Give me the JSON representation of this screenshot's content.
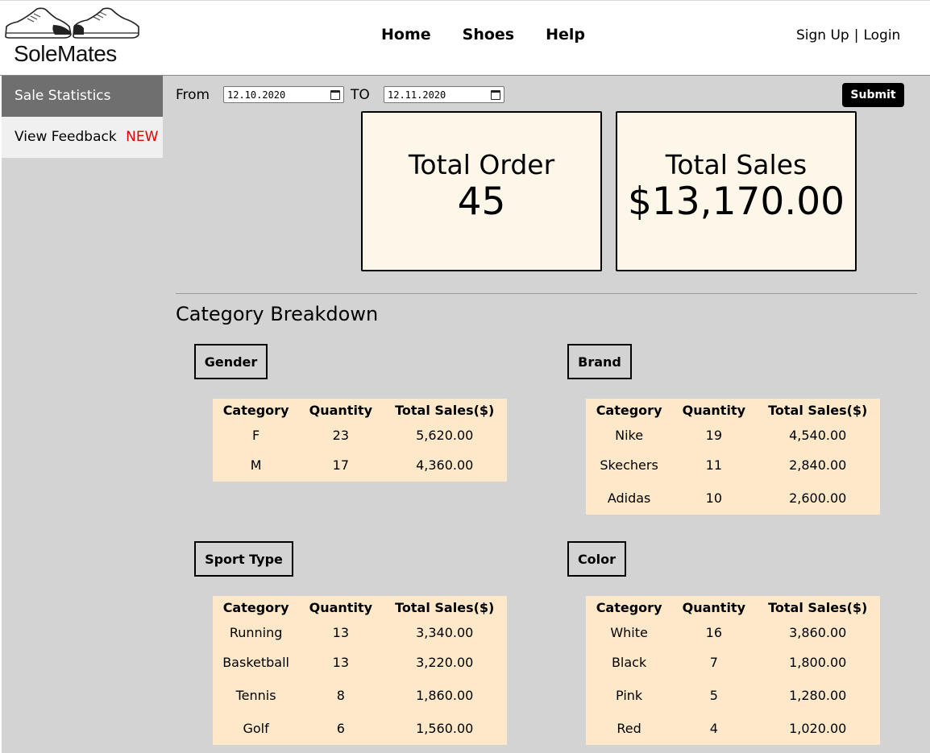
{
  "header": {
    "logo_text": "SoleMates",
    "nav": [
      "Home",
      "Shoes",
      "Help"
    ],
    "auth": {
      "signup": "Sign Up",
      "separator": "|",
      "login": "Login"
    }
  },
  "sidebar": {
    "items": [
      {
        "label": "Sale Statistics"
      },
      {
        "label": "View Feedback",
        "badge": "NEW"
      }
    ]
  },
  "filter": {
    "from_label": "From",
    "from_value": "12.10.2020",
    "to_label": "TO",
    "to_value": "12.11.2020",
    "submit_label": "Submit"
  },
  "stats": {
    "orders": {
      "title": "Total Order",
      "value": "45"
    },
    "sales": {
      "title": "Total Sales",
      "value": "$13,170.00"
    }
  },
  "breakdown": {
    "title": "Category Breakdown",
    "headers": [
      "Category",
      "Quantity",
      "Total Sales($)"
    ],
    "gender": {
      "label": "Gender",
      "rows": [
        [
          "F",
          "23",
          "5,620.00"
        ],
        [
          "M",
          "17",
          "4,360.00"
        ]
      ]
    },
    "brand": {
      "label": "Brand",
      "rows": [
        [
          "Nike",
          "19",
          "4,540.00"
        ],
        [
          "Skechers",
          "11",
          "2,840.00"
        ],
        [
          "Adidas",
          "10",
          "2,600.00"
        ]
      ]
    },
    "sport": {
      "label": "Sport Type",
      "rows": [
        [
          "Running",
          "13",
          "3,340.00"
        ],
        [
          "Basketball",
          "13",
          "3,220.00"
        ],
        [
          "Tennis",
          "8",
          "1,860.00"
        ],
        [
          "Golf",
          "6",
          "1,560.00"
        ]
      ]
    },
    "color": {
      "label": "Color",
      "rows": [
        [
          "White",
          "16",
          "3,860.00"
        ],
        [
          "Black",
          "7",
          "1,800.00"
        ],
        [
          "Pink",
          "5",
          "1,280.00"
        ],
        [
          "Red",
          "4",
          "1,020.00"
        ]
      ]
    }
  },
  "colors": {
    "sidebar_active": "#6f6f6f",
    "badge": "#e00000",
    "table_bg": "#fde9c9",
    "card_bg": "#fdf7ea",
    "page_bg": "#d3d3d3"
  }
}
